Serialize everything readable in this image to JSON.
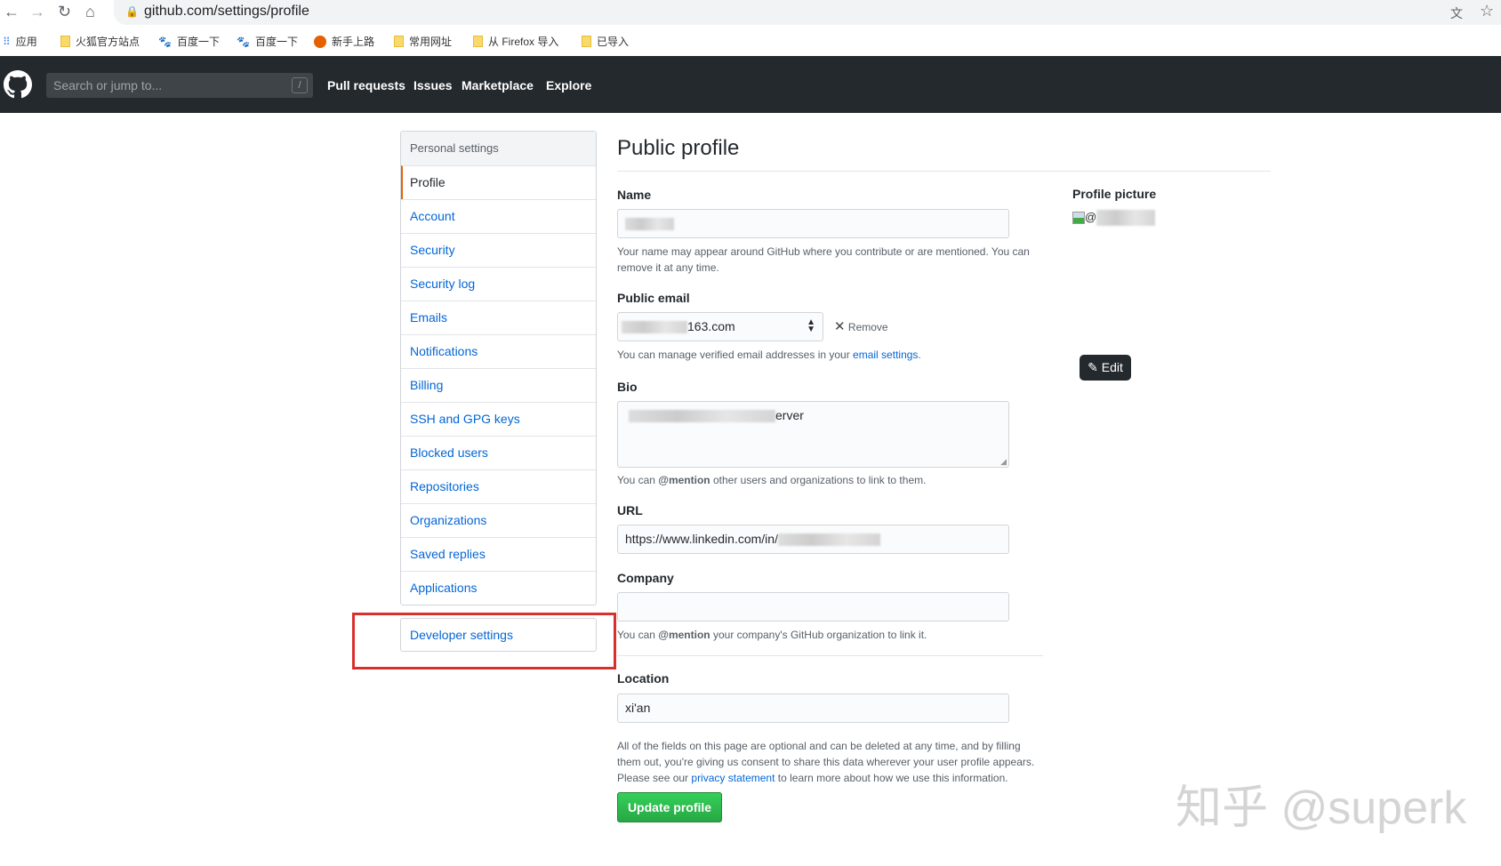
{
  "browser": {
    "url": "github.com/settings/profile",
    "bookmarks": [
      "应用",
      "火狐官方站点",
      "百度一下",
      "百度一下",
      "新手上路",
      "常用网址",
      "从 Firefox 导入",
      "已导入"
    ]
  },
  "header": {
    "search_placeholder": "Search or jump to...",
    "slash": "/",
    "nav": [
      "Pull requests",
      "Issues",
      "Marketplace",
      "Explore"
    ]
  },
  "sidebar": {
    "heading": "Personal settings",
    "items": [
      "Profile",
      "Account",
      "Security",
      "Security log",
      "Emails",
      "Notifications",
      "Billing",
      "SSH and GPG keys",
      "Blocked users",
      "Repositories",
      "Organizations",
      "Saved replies",
      "Applications"
    ],
    "developer": "Developer settings"
  },
  "main": {
    "title": "Public profile",
    "name": {
      "label": "Name",
      "note": "Your name may appear around GitHub where you contribute or are mentioned. You can remove it at any time."
    },
    "email": {
      "label": "Public email",
      "value": "163.com",
      "remove": "Remove",
      "note": "You can manage verified email addresses in your ",
      "link": "email settings",
      "end": "."
    },
    "bio": {
      "label": "Bio",
      "value": "erver",
      "note_pre": "You can ",
      "mention": "@mention",
      "note_post": " other users and organizations to link to them."
    },
    "url": {
      "label": "URL",
      "value": "https://www.linkedin.com/in/"
    },
    "company": {
      "label": "Company",
      "value": "",
      "note_pre": "You can ",
      "mention": "@mention",
      "note_post": " your company's GitHub organization to link it."
    },
    "location": {
      "label": "Location",
      "value": "xi'an"
    },
    "footer": {
      "line1": "All of the fields on this page are optional and can be deleted at any time, and by filling",
      "line2": "them out, you're giving us consent to share this data wherever your user profile appears.",
      "pre": "Please see our ",
      "link": "privacy statement",
      "post": " to learn more about how we use this information."
    },
    "update": "Update profile"
  },
  "picture": {
    "label": "Profile picture",
    "alt": "@",
    "edit": "Edit"
  },
  "watermark": "知乎 @superk",
  "colors": {
    "header": "#24292e",
    "link": "#0366d6",
    "green": "#28a745",
    "highlight": "#d9302c"
  }
}
